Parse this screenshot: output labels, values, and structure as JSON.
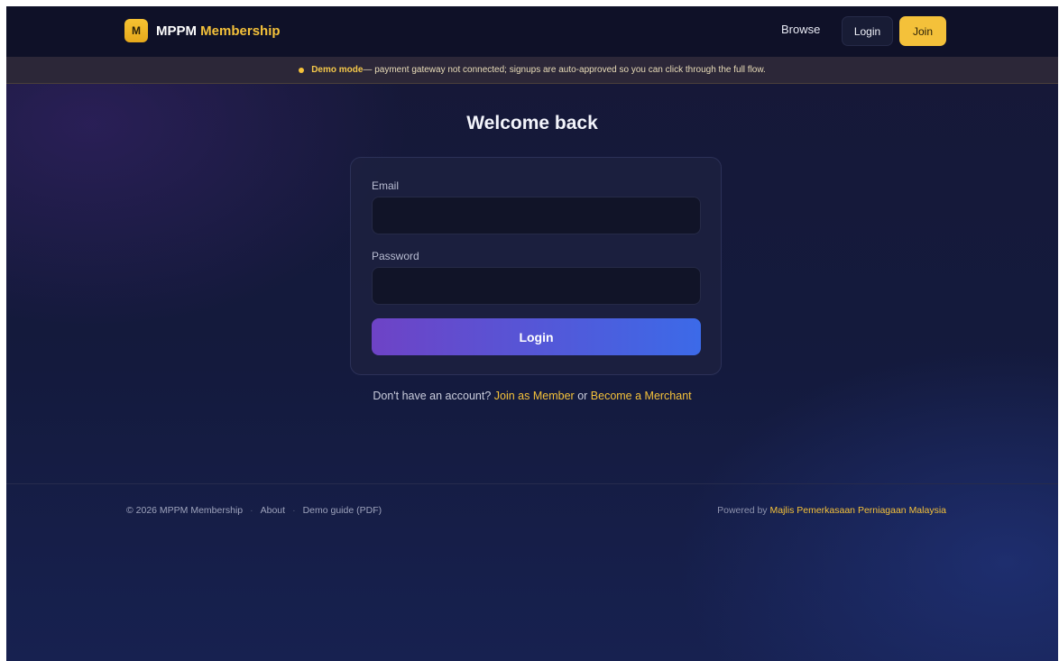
{
  "header": {
    "brand_badge": "M",
    "brand_name": "MPPM",
    "brand_accent": "Membership",
    "nav_browse": "Browse",
    "nav_login": "Login",
    "nav_join": "Join"
  },
  "banner": {
    "strong": "Demo mode",
    "text": " — payment gateway not connected; signups are auto-approved so you can click through the full flow."
  },
  "login": {
    "title": "Welcome back",
    "email_label": "Email",
    "email_value": "",
    "password_label": "Password",
    "password_value": "",
    "submit_label": "Login"
  },
  "signup": {
    "prefix": "Don't have an account? ",
    "join_member": "Join as Member",
    "or": " or ",
    "become_merchant": "Become a Merchant"
  },
  "footer": {
    "copyright": "© 2026 MPPM Membership",
    "separator": "·",
    "about": "About",
    "demo_guide": "Demo guide (PDF)",
    "powered_prefix": "Powered by ",
    "powered_org": "Majlis Pemerkasaan Perniagaan Malaysia"
  },
  "colors": {
    "accent_gold": "#f4c13a",
    "background": "#161837",
    "button_gradient_start": "#6e43c6",
    "button_gradient_end": "#3c6ae8"
  }
}
